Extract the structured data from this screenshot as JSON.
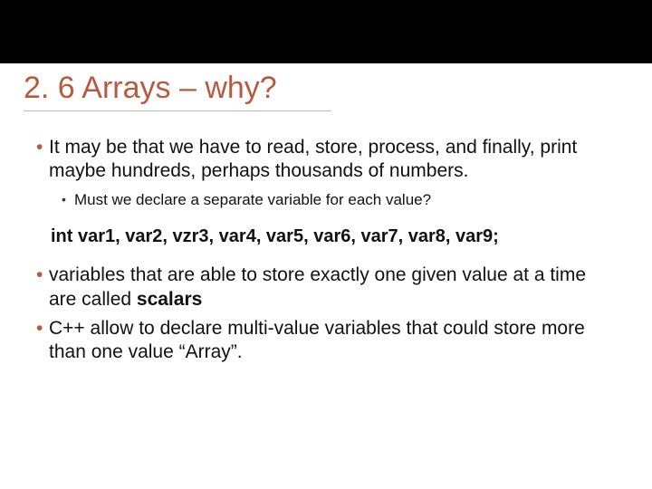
{
  "title": "2. 6 Arrays – why?",
  "bullets": {
    "b1": "It may be that we have to read, store, process, and finally, print maybe hundreds, perhaps thousands of numbers.",
    "b1a": "Must we declare a separate variable for each value?",
    "code": "int var1, var2, vzr3, var4, var5, var6, var7, var8, var9;",
    "b2_prefix": "variables that are able to store exactly one given value at a time are called ",
    "b2_bold": "scalars",
    "b3": "C++ allow to declare multi-value variables that could store more than one value “Array”."
  }
}
